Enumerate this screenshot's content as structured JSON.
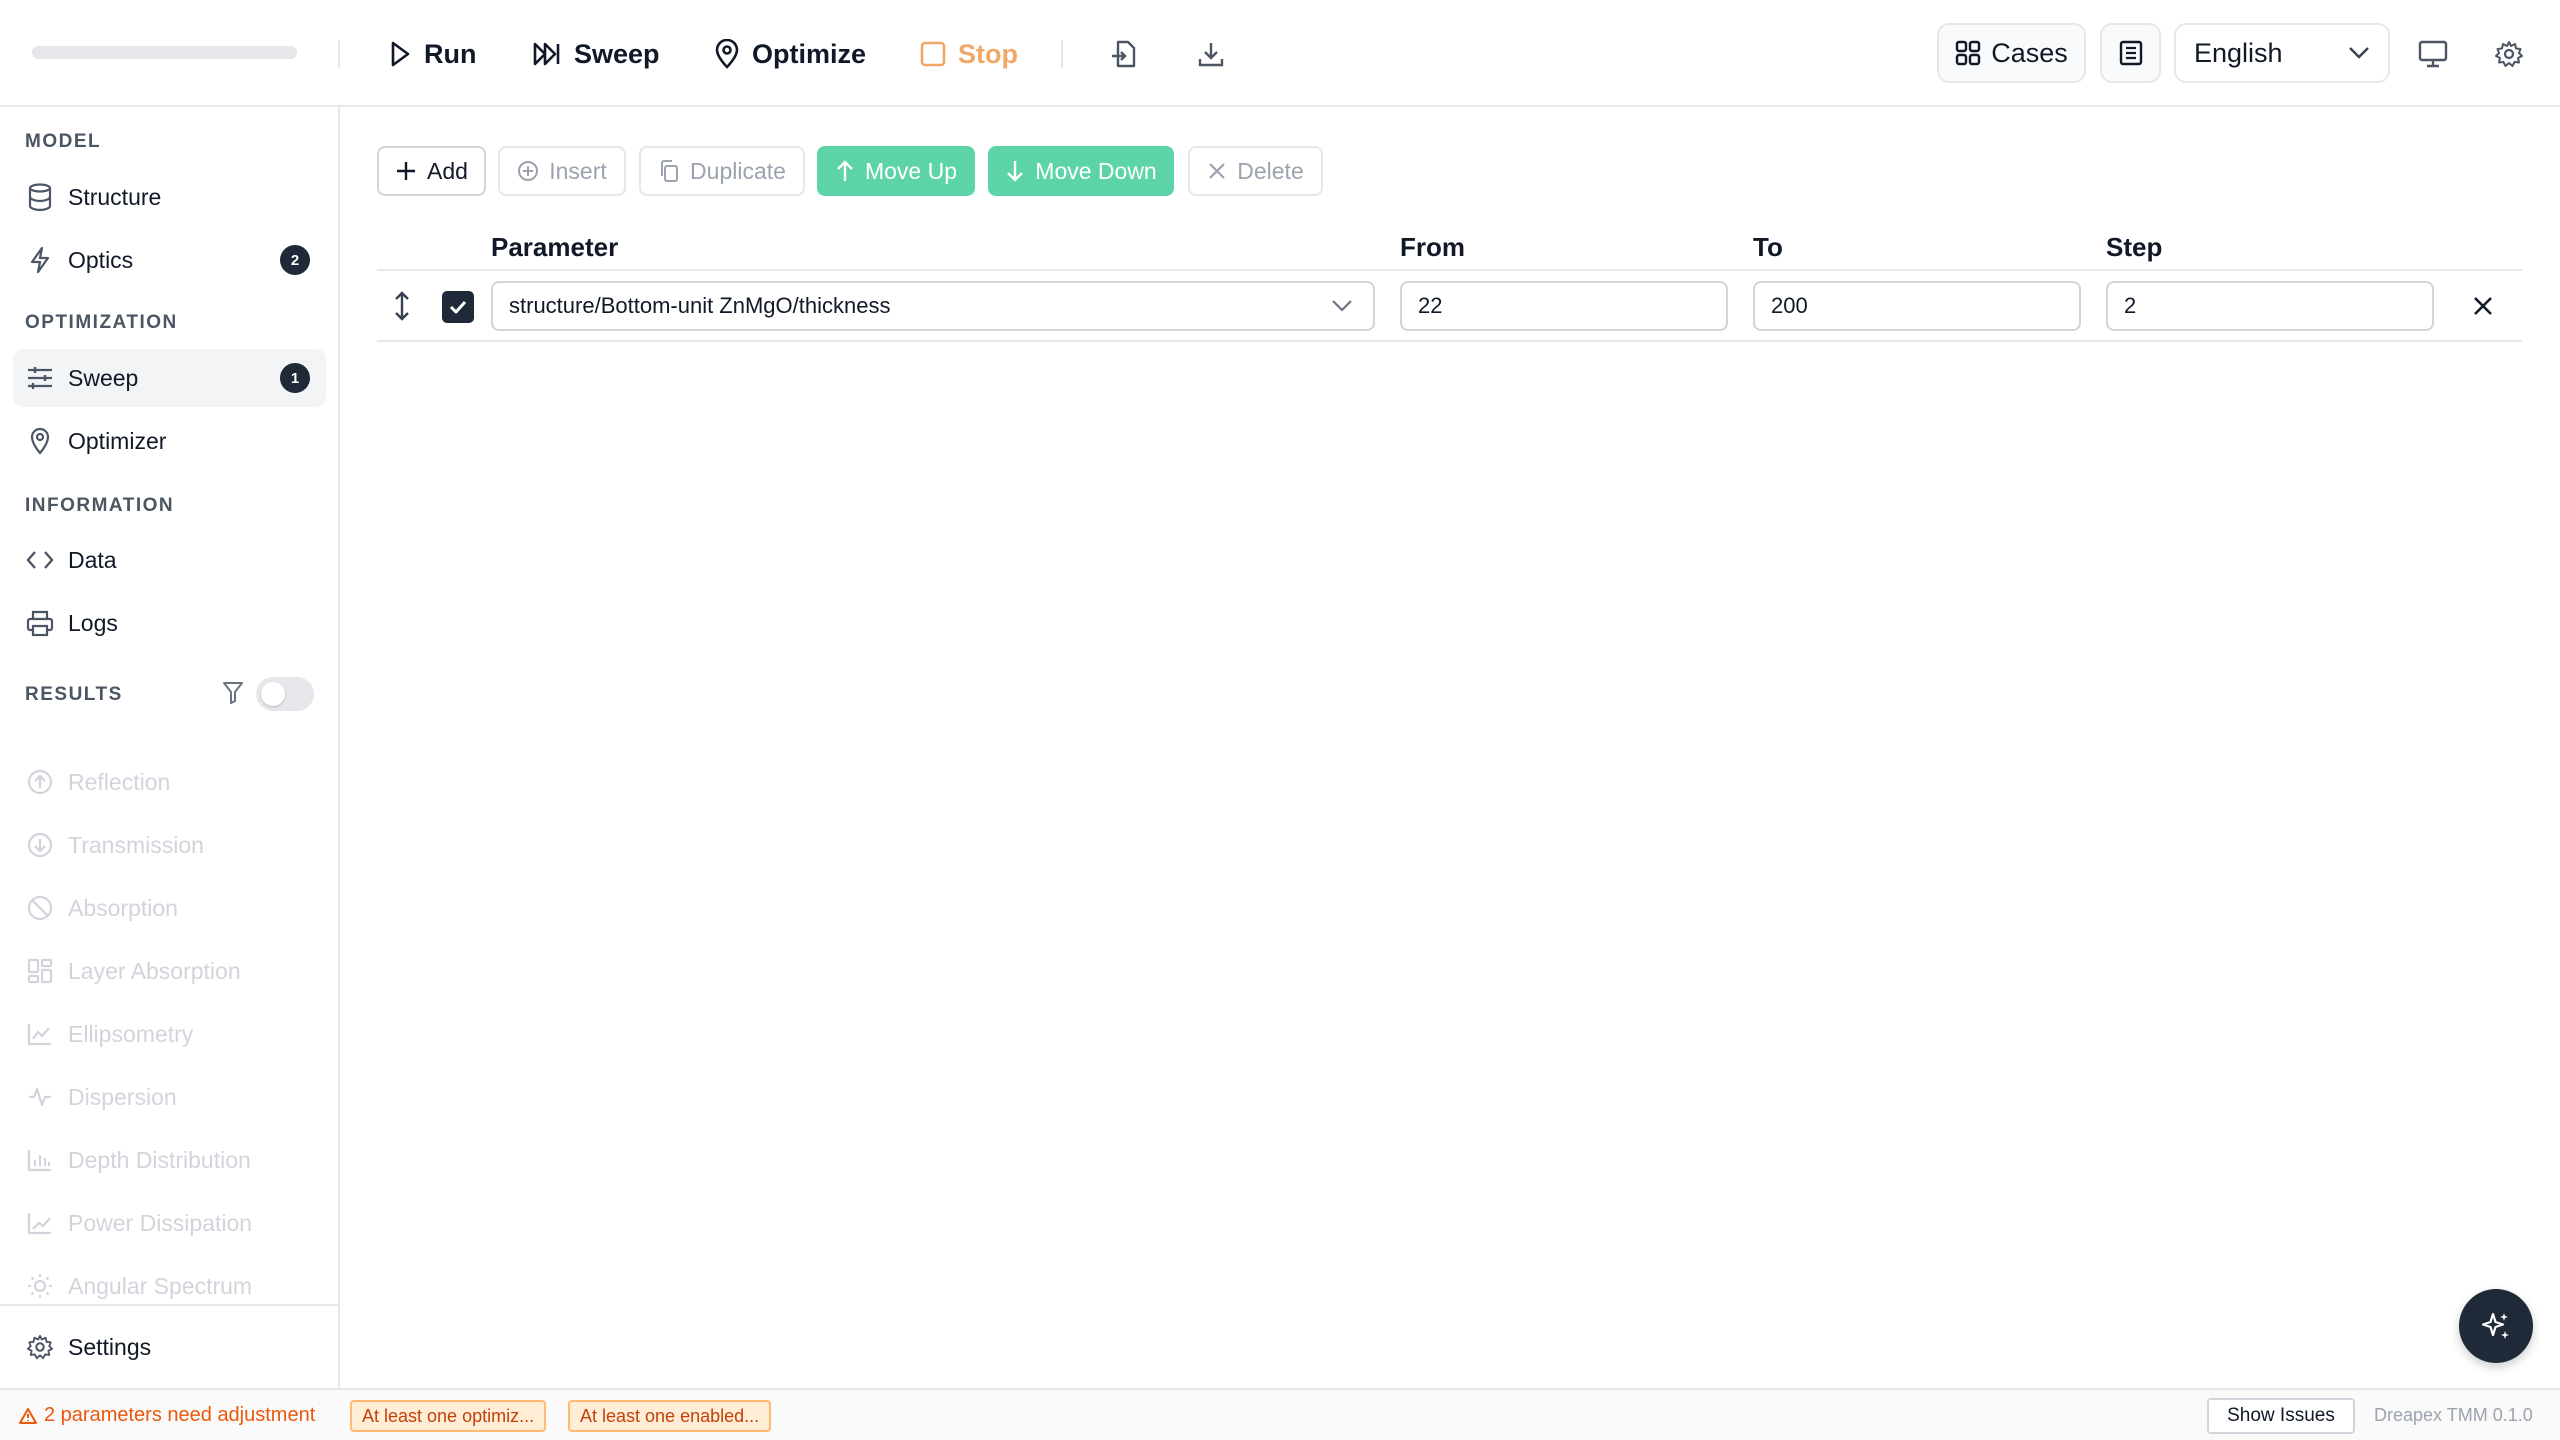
{
  "toolbar": {
    "run": "Run",
    "sweep": "Sweep",
    "optimize": "Optimize",
    "stop": "Stop",
    "cases": "Cases",
    "language": "English"
  },
  "sidebar": {
    "sections": {
      "model": "MODEL",
      "optimization": "OPTIMIZATION",
      "information": "INFORMATION",
      "results": "RESULTS"
    },
    "model_items": [
      {
        "label": "Structure",
        "icon": "database-icon"
      },
      {
        "label": "Optics",
        "icon": "lightning-icon",
        "badge": "2"
      }
    ],
    "optimization_items": [
      {
        "label": "Sweep",
        "icon": "sliders-icon",
        "badge": "1",
        "active": true
      },
      {
        "label": "Optimizer",
        "icon": "map-pin-icon"
      }
    ],
    "information_items": [
      {
        "label": "Data",
        "icon": "code-icon"
      },
      {
        "label": "Logs",
        "icon": "printer-icon"
      }
    ],
    "results_items": [
      {
        "label": "Reflection",
        "icon": "arrow-up-circle-icon"
      },
      {
        "label": "Transmission",
        "icon": "arrow-down-circle-icon"
      },
      {
        "label": "Absorption",
        "icon": "ban-icon"
      },
      {
        "label": "Layer Absorption",
        "icon": "layout-icon"
      },
      {
        "label": "Ellipsometry",
        "icon": "area-chart-icon"
      },
      {
        "label": "Dispersion",
        "icon": "activity-icon"
      },
      {
        "label": "Depth Distribution",
        "icon": "bar-chart-icon"
      },
      {
        "label": "Power Dissipation",
        "icon": "trend-chart-icon"
      },
      {
        "label": "Angular Spectrum",
        "icon": "sun-icon"
      }
    ],
    "results_filter_enabled": false,
    "settings": "Settings"
  },
  "actions": {
    "add": "Add",
    "insert": "Insert",
    "duplicate": "Duplicate",
    "move_up": "Move Up",
    "move_down": "Move Down",
    "delete": "Delete"
  },
  "table": {
    "headers": {
      "parameter": "Parameter",
      "from": "From",
      "to": "To",
      "step": "Step"
    },
    "rows": [
      {
        "enabled": true,
        "parameter": "structure/Bottom-unit ZnMgO/thickness",
        "from": "22",
        "to": "200",
        "step": "2"
      }
    ]
  },
  "status": {
    "warning": "2 parameters need adjustment",
    "chips": [
      "At least one optimiz...",
      "At least one enabled..."
    ],
    "show_issues": "Show Issues",
    "version": "Dreapex TMM 0.1.0"
  },
  "colors": {
    "accent_green": "#5dd4a8",
    "stop_orange": "#f0a868",
    "warning_orange": "#ea580c",
    "dark": "#1f2937"
  }
}
